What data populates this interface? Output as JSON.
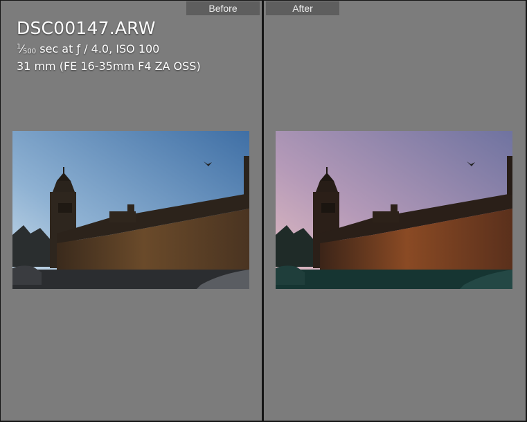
{
  "panes": {
    "before": {
      "label": "Before"
    },
    "after": {
      "label": "After"
    }
  },
  "info": {
    "filename": "DSC00147.ARW",
    "shutter_num": "1",
    "shutter_den": "500",
    "exposure_rest": " sec at ƒ / 4.0, ISO 100",
    "lens": "31 mm (FE 16-35mm F4 ZA OSS)"
  },
  "colors": {
    "pane_bg": "#7c7c7c",
    "tab_bg": "#5e5e5e",
    "divider": "#151515"
  }
}
